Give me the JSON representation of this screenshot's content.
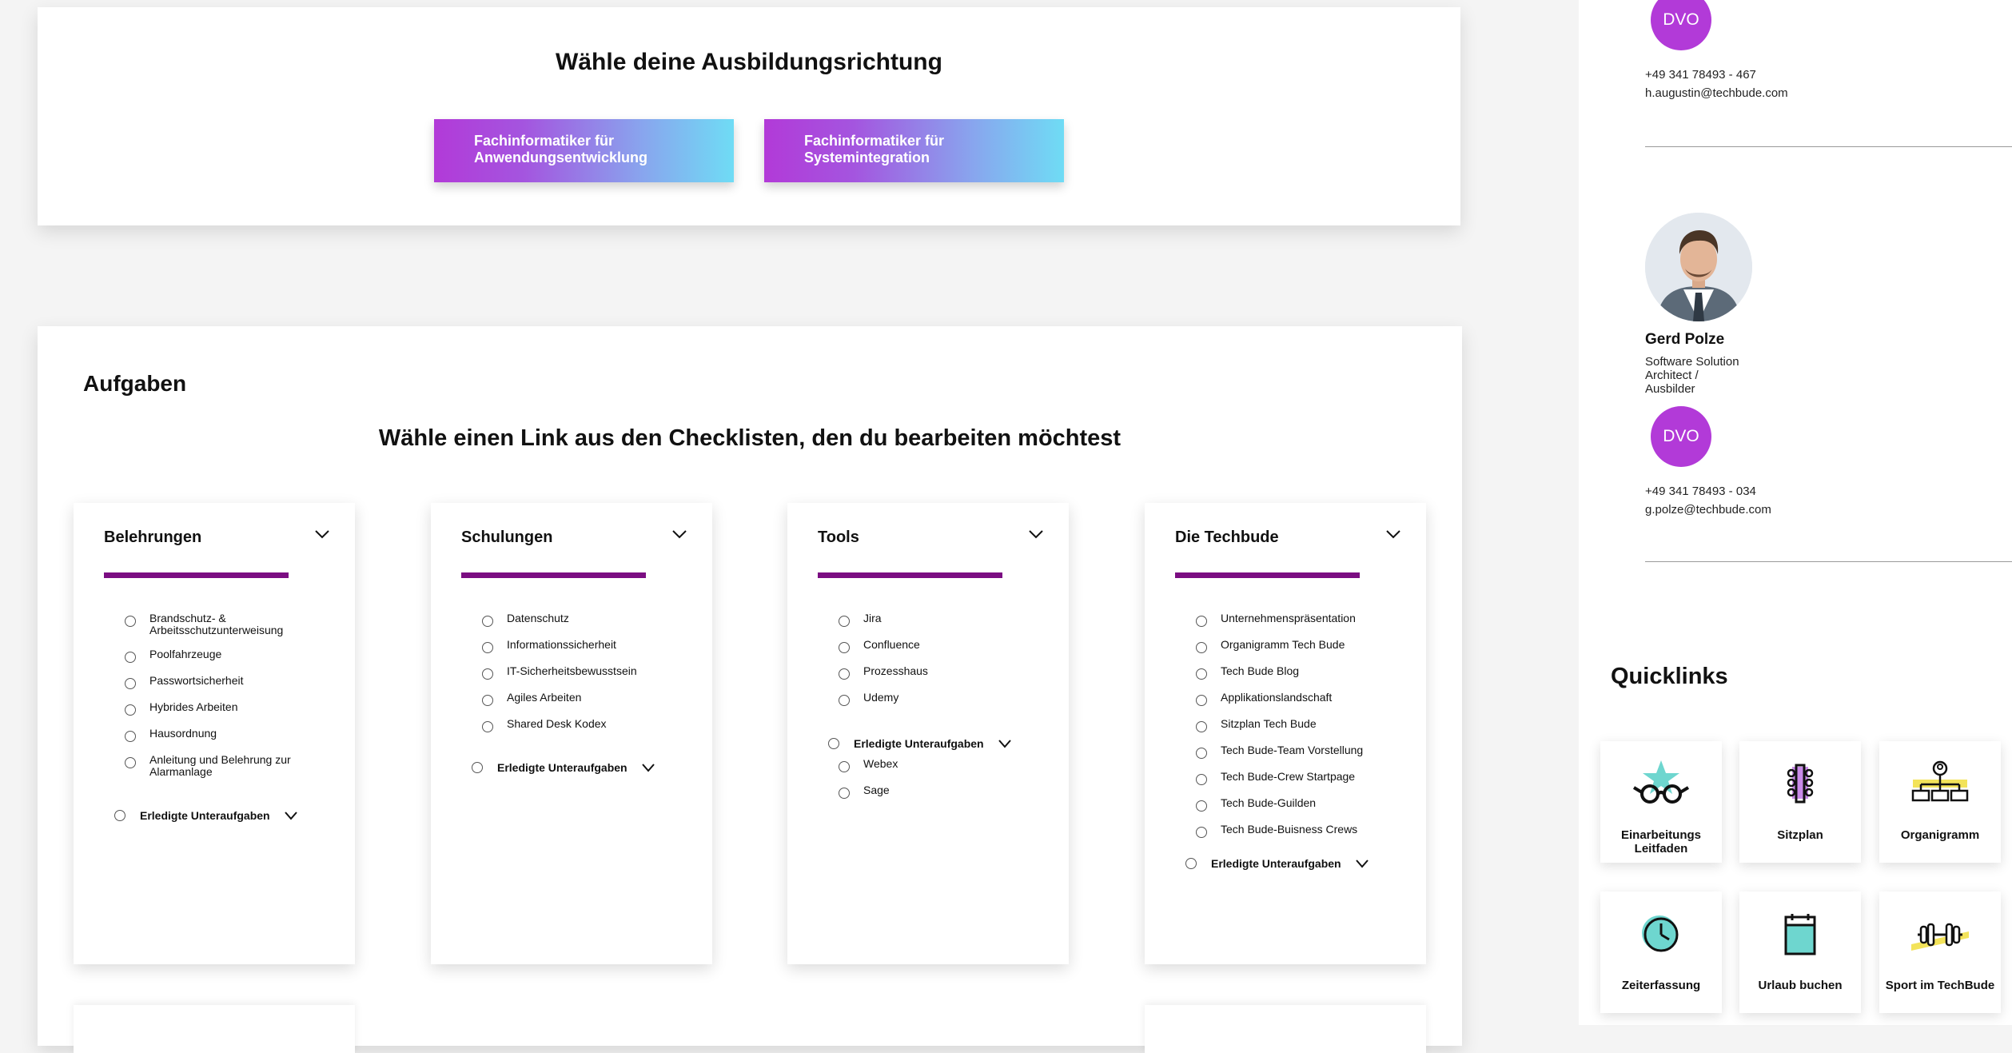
{
  "training": {
    "title": "Wähle deine Ausbildungsrichtung",
    "buttons": [
      {
        "label": "Fachinformatiker für\nAnwendungsentwicklung"
      },
      {
        "label": "Fachinformatiker für\nSystemintegration"
      }
    ]
  },
  "tasks": {
    "section_title": "Aufgaben",
    "subtitle": "Wähle einen Link aus den Checklisten, den du bearbeiten möchtest",
    "done_label": "Erledigte Unteraufgaben",
    "cards": [
      {
        "title": "Belehrungen",
        "items": [
          "Brandschutz- & Arbeitsschutzunterweisung",
          "Poolfahrzeuge",
          "Passwortsicherheit",
          "Hybrides Arbeiten",
          "Hausordnung",
          "Anleitung und Belehrung zur Alarmanlage"
        ],
        "done_items": []
      },
      {
        "title": "Schulungen",
        "items": [
          "Datenschutz",
          "Informationssicherheit",
          "IT-Sicherheitsbewusstsein",
          "Agiles Arbeiten",
          "Shared Desk Kodex"
        ],
        "done_items": []
      },
      {
        "title": "Tools",
        "items": [
          "Jira",
          "Confluence",
          "Prozesshaus",
          "Udemy"
        ],
        "done_items": [
          "Webex",
          "Sage"
        ]
      },
      {
        "title": "Die Techbude",
        "items": [
          "Unternehmenspräsentation",
          "Organigramm Tech Bude",
          "Tech Bude Blog",
          "Applikationslandschaft",
          "Sitzplan Tech Bude",
          "Tech Bude-Team Vorstellung",
          "Tech Bude-Crew Startpage",
          "Tech Bude-Guilden",
          "Tech Bude-Buisness Crews"
        ],
        "done_items": []
      }
    ]
  },
  "contacts": [
    {
      "badge": "DVO",
      "phone": "+49 341 78493 - 467",
      "email": "h.augustin@techbude.com"
    },
    {
      "name": "Gerd Polze",
      "role": "Software Solution\nArchitect /\nAusbilder",
      "badge": "DVO",
      "phone": "+49 341 78493 - 034",
      "email": "g.polze@techbude.com"
    }
  ],
  "quicklinks": {
    "title": "Quicklinks",
    "tiles": [
      {
        "label": "Einarbeitungs\nLeitfaden",
        "icon": "glasses-star-icon"
      },
      {
        "label": "Sitzplan",
        "icon": "seating-plan-icon"
      },
      {
        "label": "Organigramm",
        "icon": "org-chart-icon"
      },
      {
        "label": "Zeiterfassung",
        "icon": "clock-icon"
      },
      {
        "label": "Urlaub buchen",
        "icon": "calendar-icon"
      },
      {
        "label": "Sport im TechBude",
        "icon": "dumbbell-icon"
      }
    ]
  },
  "colors": {
    "accent_purple": "#b23ad8",
    "accent_cyan": "#6fdcf5",
    "bar_purple": "#7b0d82",
    "teal": "#6ed6cf",
    "lilac": "#c98be8",
    "yellow": "#f3e35a"
  }
}
